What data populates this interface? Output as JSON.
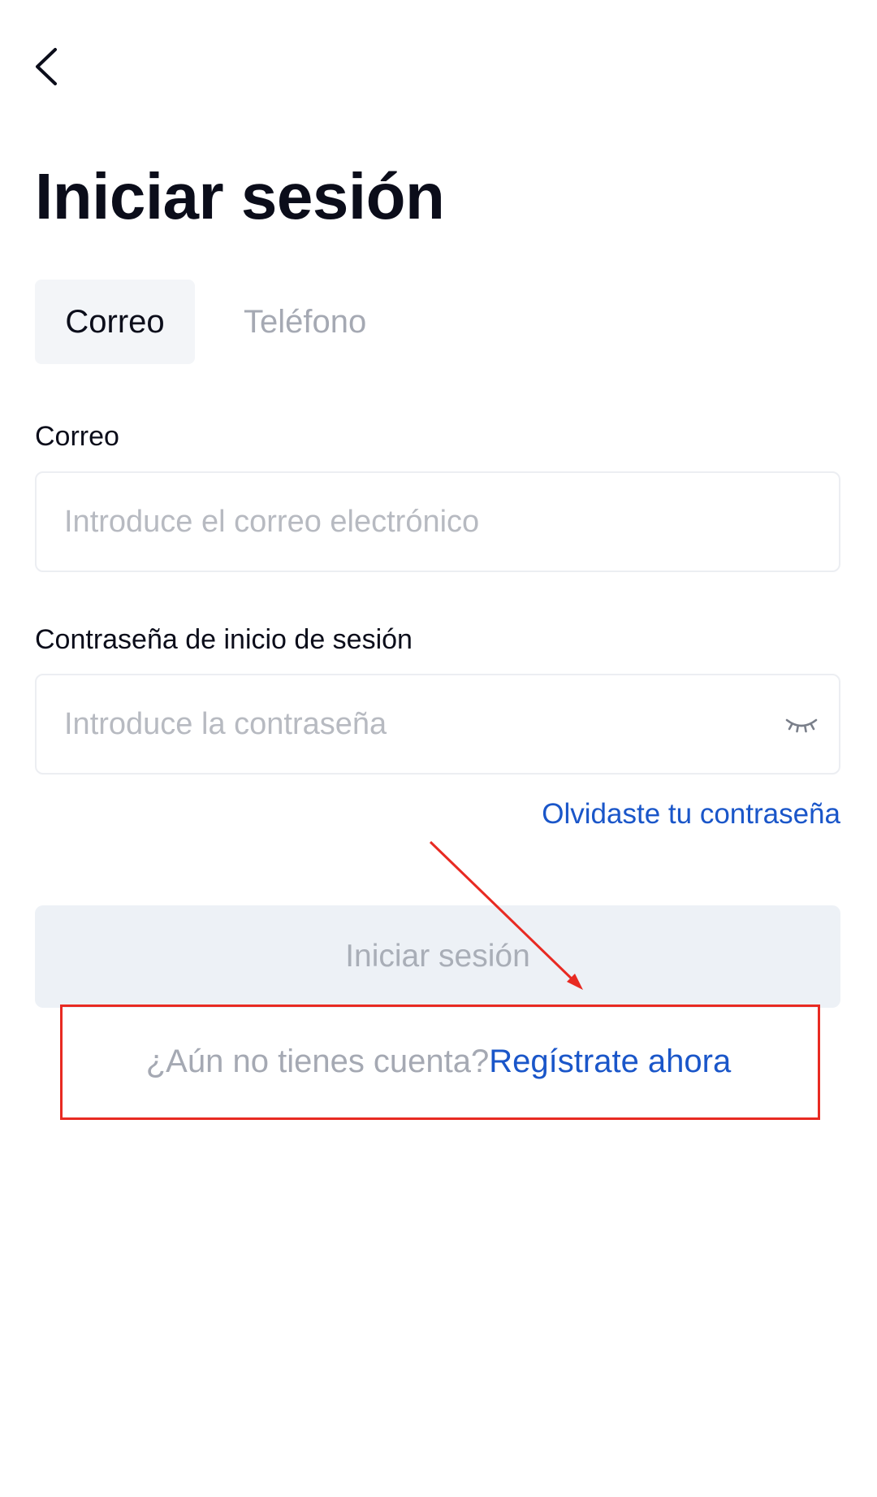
{
  "header": {
    "back_icon": "chevron-left-icon"
  },
  "title": "Iniciar sesión",
  "tabs": [
    {
      "label": "Correo",
      "active": true
    },
    {
      "label": "Teléfono",
      "active": false
    }
  ],
  "email_field": {
    "label": "Correo",
    "placeholder": "Introduce el correo electrónico",
    "value": ""
  },
  "password_field": {
    "label": "Contraseña de inicio de sesión",
    "placeholder": "Introduce la contraseña",
    "value": "",
    "toggle_icon": "eye-closed-icon"
  },
  "forgot_password": "Olvidaste tu contraseña",
  "login_button": "Iniciar sesión",
  "register": {
    "question": "¿Aún no tienes cuenta?",
    "link": "Regístrate ahora"
  },
  "colors": {
    "link": "#1a56c9",
    "annotation": "#e82a22",
    "disabled_button_bg": "#edf1f6"
  }
}
